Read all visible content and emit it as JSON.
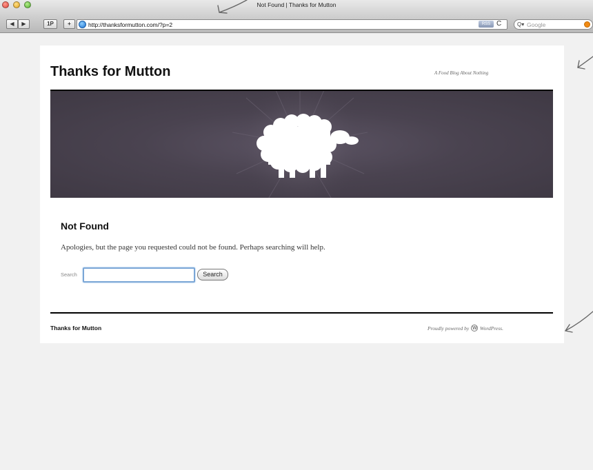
{
  "browser": {
    "window_title": "Not Found | Thanks for Mutton",
    "url": "http://thanksformutton.com/?p=2",
    "toolbar": {
      "back_label": "◀",
      "forward_label": "▶",
      "onepassword_label": "1P",
      "add_bookmark_label": "+",
      "rss_label": "RSS",
      "reload_label": "C",
      "search_placeholder": "Google"
    }
  },
  "site": {
    "title": "Thanks for Mutton",
    "description": "A Food Blog About Nothing"
  },
  "entry": {
    "title": "Not Found",
    "text": "Apologies, but the page you requested could not be found. Perhaps searching will help."
  },
  "search": {
    "label": "Search",
    "value": "",
    "button_label": "Search"
  },
  "footer": {
    "site_title": "Thanks for Mutton",
    "credit_prefix": "Proudly powered by",
    "credit_link": "WordPress."
  },
  "colors": {
    "banner_background": "#4a4350",
    "page_background": "#ffffff",
    "canvas_background": "#f1f1f1",
    "annotation_stroke": "#777777"
  },
  "icons": {
    "globe": "globe-icon",
    "wordpress": "wordpress-logo-icon",
    "sheep": "sheep-icon"
  }
}
